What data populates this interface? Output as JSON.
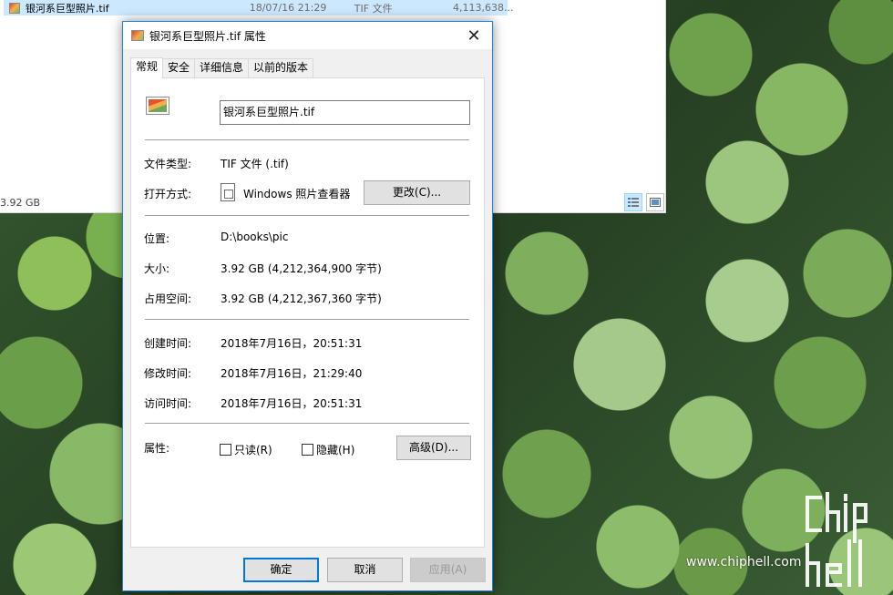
{
  "explorer": {
    "row": {
      "name": "银河系巨型照片.tif",
      "date": "18/07/16 21:29",
      "type": "TIF 文件",
      "size": "4,113,638..."
    },
    "status_size": "3.92 GB"
  },
  "dialog": {
    "title": "银河系巨型照片.tif 属性",
    "tabs": [
      "常规",
      "安全",
      "详细信息",
      "以前的版本"
    ],
    "file_name": "银河系巨型照片.tif",
    "labels": {
      "file_type": "文件类型:",
      "open_with": "打开方式:",
      "location": "位置:",
      "size": "大小:",
      "size_on_disk": "占用空间:",
      "created": "创建时间:",
      "modified": "修改时间:",
      "accessed": "访问时间:",
      "attributes": "属性:"
    },
    "values": {
      "file_type": "TIF 文件 (.tif)",
      "open_with": "Windows 照片查看器",
      "location": "D:\\books\\pic",
      "size": "3.92 GB (4,212,364,900 字节)",
      "size_on_disk": "3.92 GB (4,212,367,360 字节)",
      "created": "2018年7月16日，20:51:31",
      "modified": "2018年7月16日，21:29:40",
      "accessed": "2018年7月16日，20:51:31"
    },
    "buttons": {
      "change": "更改(C)...",
      "advanced": "高级(D)...",
      "ok": "确定",
      "cancel": "取消",
      "apply": "应用(A)"
    },
    "checkboxes": {
      "readonly": "只读(R)",
      "hidden": "隐藏(H)"
    },
    "close_glyph": "✕"
  },
  "watermark": {
    "url": "www.chiphell.com"
  }
}
